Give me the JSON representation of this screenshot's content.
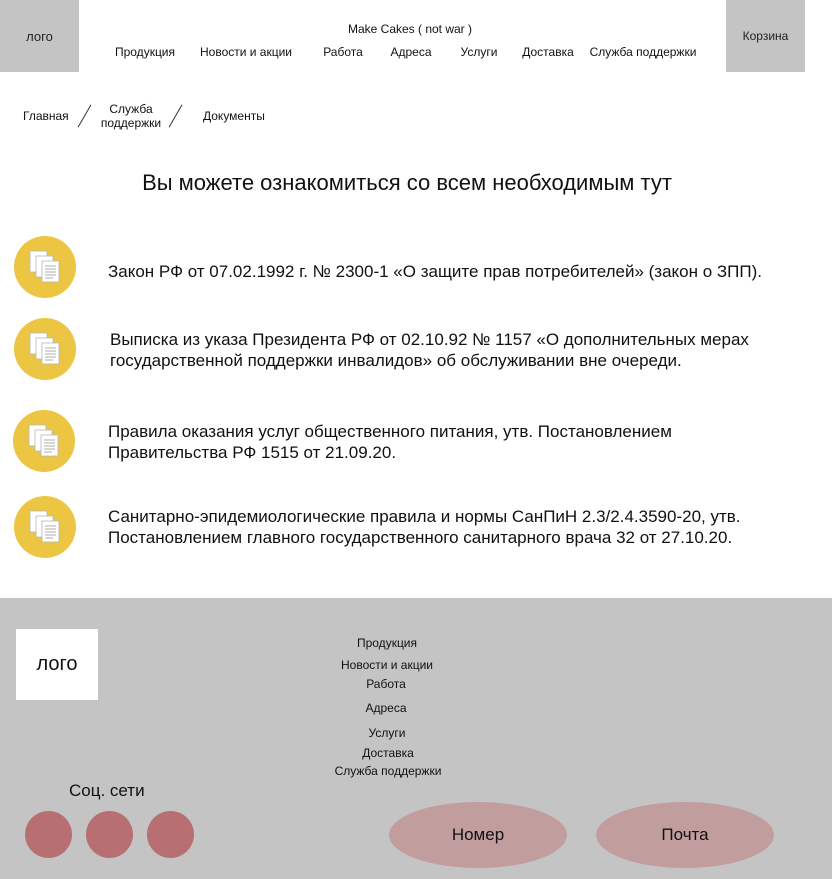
{
  "header": {
    "logo": "лого",
    "site_title": "Make Cakes ( not war )",
    "cart": "Корзина",
    "nav": [
      {
        "label": "Продукция"
      },
      {
        "label": "Новости и акции"
      },
      {
        "label": "Работа"
      },
      {
        "label": "Адреса"
      },
      {
        "label": "Услуги"
      },
      {
        "label": "Доставка"
      },
      {
        "label": "Служба поддержки"
      }
    ]
  },
  "breadcrumb": {
    "home": "Главная",
    "support_line1": "Служба",
    "support_line2": "поддержки",
    "current": "Документы"
  },
  "page": {
    "heading": "Вы можете ознакомиться со всем необходимым тут"
  },
  "documents": [
    {
      "icon": "document-icon",
      "line1": "Закон РФ от 07.02.1992 г. № 2300-1 «О защите прав потребителей» (закон о ЗПП).",
      "line2": ""
    },
    {
      "icon": "document-icon",
      "line1": "Выписка из указа Президента РФ от 02.10.92 № 1157 «О дополнительных мерах",
      "line2": "государственной поддержки инвалидов» об обслуживании вне очереди."
    },
    {
      "icon": "document-icon",
      "line1": "Правила оказания услуг общественного питания, утв. Постановлением",
      "line2": "Правительства РФ 1515 от 21.09.20."
    },
    {
      "icon": "document-icon",
      "line1": "Санитарно-эпидемиологические правила и нормы СанПиН 2.3/2.4.3590-20, утв.",
      "line2": "Постановлением главного государственного санитарного врача 32 от 27.10.20."
    }
  ],
  "footer": {
    "logo": "лого",
    "links": [
      {
        "label": "Продукция"
      },
      {
        "label": "Новости и акции"
      },
      {
        "label": "Работа"
      },
      {
        "label": "Адреса"
      },
      {
        "label": "Услуги"
      },
      {
        "label": "Доставка"
      },
      {
        "label": "Служба поддержки"
      }
    ],
    "social_title": "Соц. сети",
    "phone_label": "Номер",
    "email_label": "Почта"
  },
  "colors": {
    "header_gray": "#c4c4c4",
    "doc_icon_yellow": "#ecc642",
    "social_red": "#b86f71",
    "contact_pink": "#c29d9e"
  }
}
